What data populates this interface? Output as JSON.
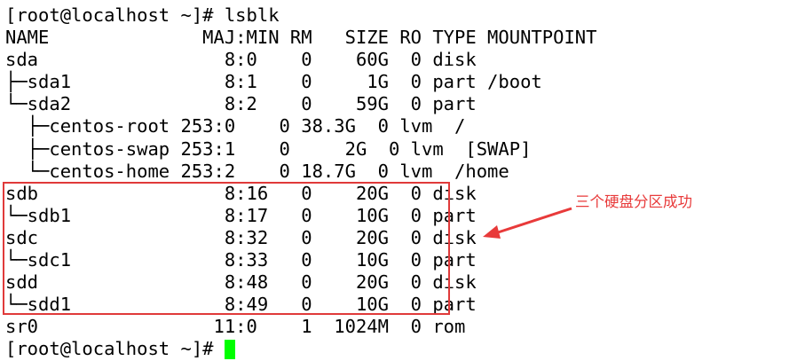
{
  "terminal": {
    "lines": [
      "[root@localhost ~]# lsblk",
      "NAME              MAJ:MIN RM   SIZE RO TYPE MOUNTPOINT",
      "sda                 8:0    0    60G  0 disk",
      "├─sda1              8:1    0     1G  0 part /boot",
      "└─sda2              8:2    0    59G  0 part",
      "  ├─centos-root 253:0    0 38.3G  0 lvm  /",
      "  ├─centos-swap 253:1    0     2G  0 lvm  [SWAP]",
      "  └─centos-home 253:2    0 18.7G  0 lvm  /home",
      "sdb                 8:16   0    20G  0 disk",
      "└─sdb1              8:17   0    10G  0 part",
      "sdc                 8:32   0    20G  0 disk",
      "└─sdc1              8:33   0    10G  0 part",
      "sdd                 8:48   0    20G  0 disk",
      "└─sdd1              8:49   0    10G  0 part",
      "sr0                11:0    1  1024M  0 rom"
    ],
    "prompt": "[root@localhost ~]#"
  },
  "annotation": {
    "text": "三个硬盘分区成功",
    "color": "#e83a3a"
  },
  "colors": {
    "cursor": "#00ff00",
    "highlight_border": "#e03a3a"
  }
}
